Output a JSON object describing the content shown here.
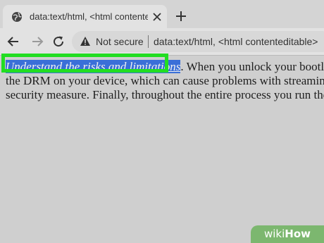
{
  "tab": {
    "icon": "globe-icon",
    "title": "data:text/html, <html contentedit",
    "close_icon": "close-icon",
    "new_tab_icon": "plus-icon"
  },
  "toolbar": {
    "back_icon": "arrow-left-icon",
    "forward_icon": "arrow-right-icon",
    "reload_icon": "reload-icon",
    "security_icon": "warning-icon",
    "security_label": "Not secure",
    "url": "data:text/html, <html contenteditable>"
  },
  "page": {
    "highlighted": "Understand the risks and limitations",
    "line1_rest": ". When you unlock your bootloader, ",
    "line2": "the DRM on your device, which can cause problems with streaming music",
    "line3": "security measure. Finally, throughout the entire process you run the risk of"
  },
  "colors": {
    "selection": "#3a6fd8",
    "callout_border": "#22dd22",
    "watermark_bg": "#7cb76f"
  },
  "watermark": {
    "wiki": "wiki",
    "how": "How"
  }
}
